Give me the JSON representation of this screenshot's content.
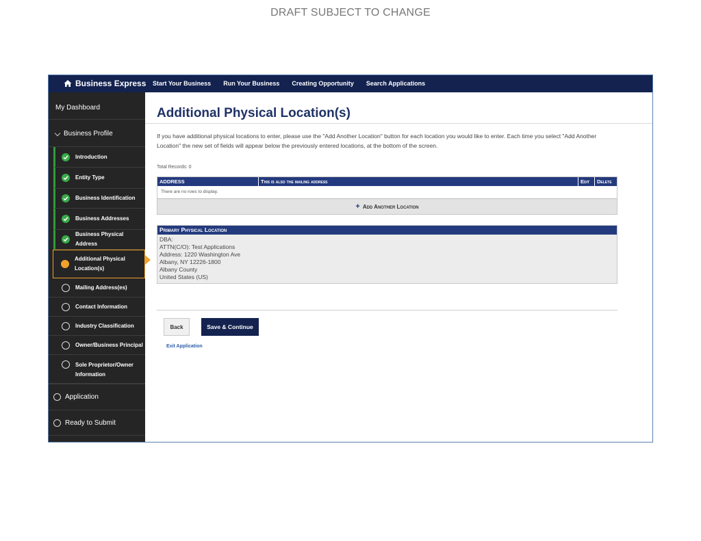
{
  "banner": {
    "draft": "DRAFT SUBJECT TO CHANGE"
  },
  "topnav": {
    "brand": "Business Express",
    "links": [
      "Start Your Business",
      "Run Your Business",
      "Creating Opportunity",
      "Search Applications"
    ]
  },
  "sidebar": {
    "dashboard": "My Dashboard",
    "profile": "Business Profile",
    "steps": [
      {
        "label": "Introduction",
        "status": "done"
      },
      {
        "label": "Entity Type",
        "status": "done"
      },
      {
        "label": "Business Identification",
        "status": "done"
      },
      {
        "label": "Business Addresses",
        "status": "done"
      },
      {
        "label": "Business Physical Address",
        "status": "done"
      },
      {
        "label": "Additional Physical Location(s)",
        "status": "current"
      },
      {
        "label": "Mailing Address(es)",
        "status": "todo"
      },
      {
        "label": "Contact Information",
        "status": "todo"
      },
      {
        "label": "Industry Classification",
        "status": "todo"
      },
      {
        "label": "Owner/Business Principal",
        "status": "todo"
      },
      {
        "label": "Sole Proprietor/Owner Information",
        "status": "todo"
      }
    ],
    "sections": [
      "Application",
      "Ready to Submit"
    ]
  },
  "main": {
    "title": "Additional Physical Location(s)",
    "intro": "If you have additional physical locations to enter, please use the \"Add Another Location\" button for each location you would like to enter. Each time you select \"Add Another Location\" the new set of fields will appear below the previously entered locations, at the bottom of the screen.",
    "total_records": "Total Records: 0",
    "grid": {
      "headers": {
        "address": "ADDRESS",
        "mailing": "This is also the mailing address",
        "edit": "Edit",
        "delete": "Delete"
      },
      "empty": "There are no rows to display.",
      "add_label": "Add Another Location"
    },
    "primary": {
      "heading": "Primary Physical Location",
      "lines": [
        "DBA:",
        "ATTN(C/O): Test Applications",
        "Address: 1220 Washington Ave",
        "Albany, NY 12226-1800",
        "Albany County",
        "United States (US)"
      ]
    },
    "buttons": {
      "back": "Back",
      "save": "Save & Continue",
      "exit": "Exit Application"
    }
  },
  "colors": {
    "navy": "#13224f",
    "header_blue": "#243a7e",
    "done_green": "#3aa94a",
    "current_orange": "#f0a22a"
  }
}
